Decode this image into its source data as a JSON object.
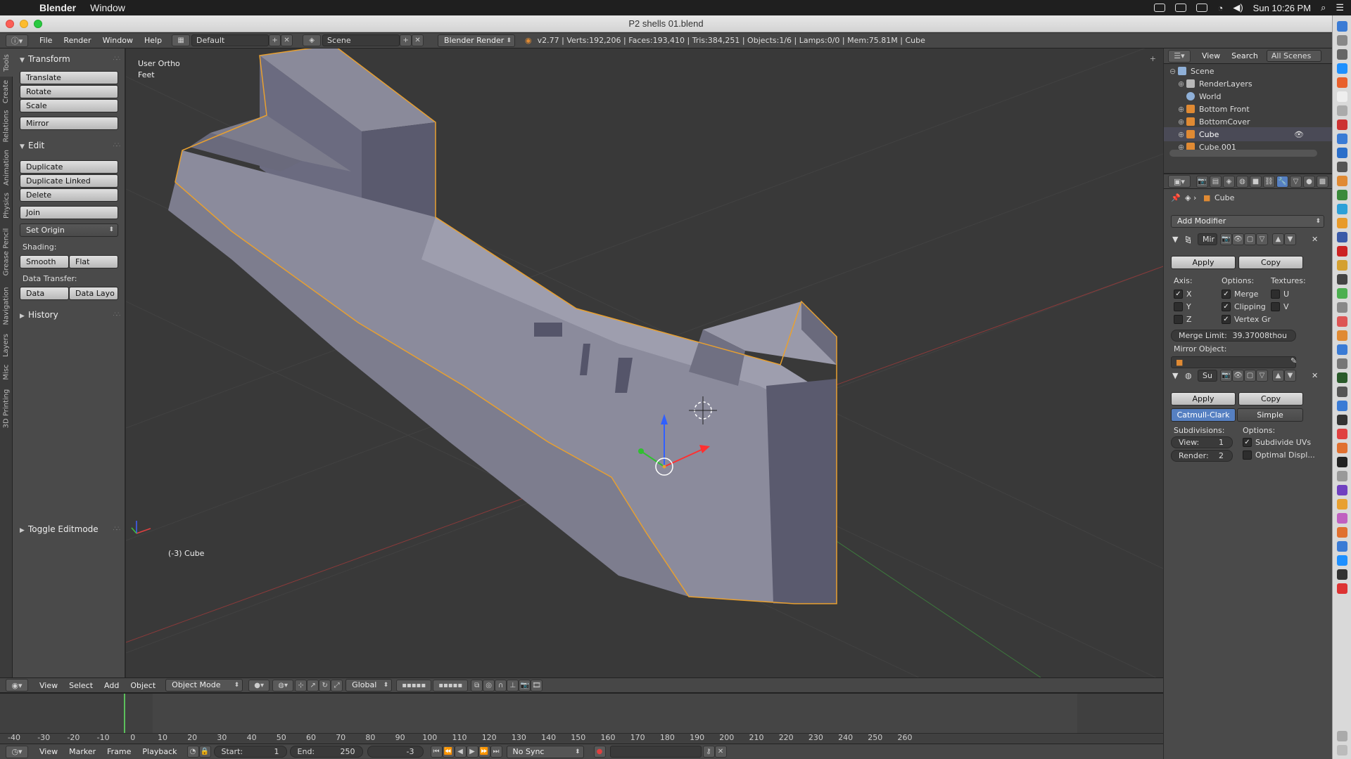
{
  "macbar": {
    "app_name": "Blender",
    "menu": "Window",
    "clock": "Sun 10:26 PM"
  },
  "titlebar": {
    "title": "P2 shells 01.blend"
  },
  "infobar": {
    "menus": [
      "File",
      "Render",
      "Window",
      "Help"
    ],
    "layout": "Default",
    "scene": "Scene",
    "engine": "Blender Render",
    "stats": "v2.77 | Verts:192,206 | Faces:193,410 | Tris:384,251 | Objects:1/6 | Lamps:0/0 | Mem:75.81M | Cube"
  },
  "tabstrip": [
    "Tools",
    "Create",
    "Relations",
    "Animation",
    "Physics",
    "Grease Pencil",
    "Navigation",
    "Layers",
    "Misc",
    "3D Printing"
  ],
  "toolshelf": {
    "transform_header": "Transform",
    "translate": "Translate",
    "rotate": "Rotate",
    "scale": "Scale",
    "mirror": "Mirror",
    "edit_header": "Edit",
    "duplicate": "Duplicate",
    "duplicate_linked": "Duplicate Linked",
    "delete": "Delete",
    "join": "Join",
    "set_origin": "Set Origin",
    "shading_label": "Shading:",
    "smooth": "Smooth",
    "flat": "Flat",
    "data_transfer_label": "Data Transfer:",
    "data": "Data",
    "data_layout": "Data Layo",
    "history_header": "History",
    "toggle_editmode": "Toggle Editmode"
  },
  "viewport": {
    "view_name": "User Ortho",
    "units": "Feet",
    "object_label": "(-3) Cube"
  },
  "vpheader": {
    "menus": [
      "View",
      "Select",
      "Add",
      "Object"
    ],
    "mode": "Object Mode",
    "orientation": "Global"
  },
  "timeline": {
    "ticks": [
      -40,
      -30,
      -20,
      -10,
      0,
      10,
      20,
      30,
      40,
      50,
      60,
      70,
      80,
      90,
      100,
      110,
      120,
      130,
      140,
      150,
      160,
      170,
      180,
      190,
      200,
      210,
      220,
      230,
      240,
      250,
      260
    ],
    "current_frame": -3
  },
  "tlheader": {
    "menus": [
      "View",
      "Marker",
      "Frame",
      "Playback"
    ],
    "start_label": "Start:",
    "start_value": "1",
    "end_label": "End:",
    "end_value": "250",
    "current": "-3",
    "sync": "No Sync"
  },
  "outliner": {
    "menus": [
      "View",
      "Search"
    ],
    "filter": "All Scenes",
    "items": [
      {
        "label": "Scene",
        "color": "#8fb0d8"
      },
      {
        "label": "RenderLayers",
        "color": "#b8b8b8"
      },
      {
        "label": "World",
        "color": "#8fb0d8"
      },
      {
        "label": "Bottom Front",
        "color": "#e08a33"
      },
      {
        "label": "BottomCover",
        "color": "#e08a33"
      },
      {
        "label": "Cube",
        "color": "#e08a33"
      },
      {
        "label": "Cube.001",
        "color": "#e08a33"
      }
    ]
  },
  "props": {
    "object_name": "Cube",
    "add_modifier": "Add Modifier",
    "mirror": {
      "name": "Mir",
      "apply": "Apply",
      "copy": "Copy",
      "axis_label": "Axis:",
      "options_label": "Options:",
      "textures_label": "Textures:",
      "x": "X",
      "y": "Y",
      "z": "Z",
      "merge": "Merge",
      "clipping": "Clipping",
      "vertex_groups": "Vertex Gr",
      "u": "U",
      "v": "V",
      "merge_limit_label": "Merge Limit:",
      "merge_limit_value": "39.37008thou",
      "mirror_object_label": "Mirror Object:"
    },
    "subsurf": {
      "name": "Su",
      "apply": "Apply",
      "copy": "Copy",
      "catmull": "Catmull-Clark",
      "simple": "Simple",
      "subdivisions_label": "Subdivisions:",
      "options_label": "Options:",
      "view_label": "View:",
      "view_value": "1",
      "render_label": "Render:",
      "render_value": "2",
      "subdivide_uvs": "Subdivide UVs",
      "optimal_display": "Optimal Displ..."
    }
  }
}
